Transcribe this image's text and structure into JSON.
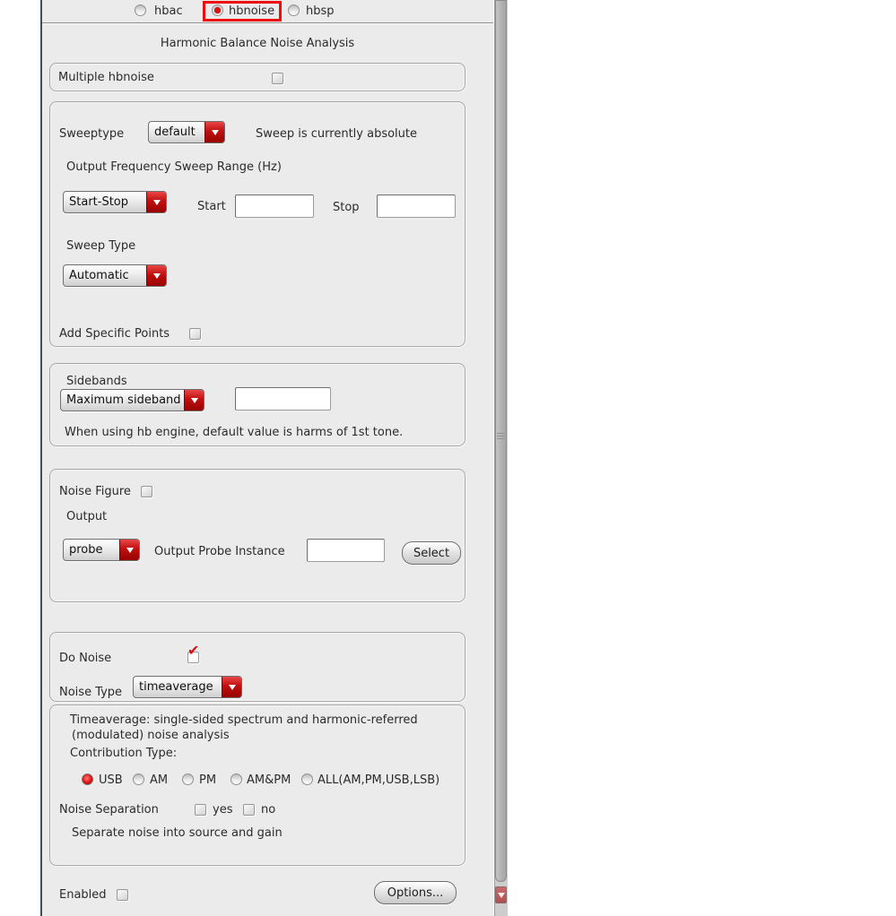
{
  "colors": {
    "accent_red": "#c40b0b",
    "highlight_box": "#ee0d0d",
    "panel_bg": "#ebebeb",
    "text": "#2b2b2b"
  },
  "icons": {
    "checkmark": "✔",
    "dropdown_arrow": "triangle-down",
    "scroll_down": "triangle-down"
  },
  "analysis_tabs": {
    "items": [
      {
        "label": "hbac",
        "selected": false
      },
      {
        "label": "hbnoise",
        "selected": true,
        "highlighted": true
      },
      {
        "label": "hbsp",
        "selected": false
      }
    ]
  },
  "header": {
    "title": "Harmonic Balance Noise Analysis"
  },
  "multiple_hbnoise": {
    "label": "Multiple hbnoise",
    "checked": false
  },
  "sweep_section": {
    "sweeptype_label": "Sweeptype",
    "sweeptype_value": "default",
    "sweep_status": "Sweep is currently absolute",
    "range_title": "Output Frequency Sweep Range (Hz)",
    "range_mode_value": "Start-Stop",
    "start_label": "Start",
    "start_value": "",
    "stop_label": "Stop",
    "stop_value": "",
    "sweep_type_label": "Sweep Type",
    "sweep_type_value": "Automatic",
    "add_points_label": "Add Specific Points",
    "add_points_checked": false
  },
  "sidebands_section": {
    "label": "Sidebands",
    "mode_value": "Maximum sideband",
    "value": "",
    "note": "When using hb engine, default value is harms of 1st tone."
  },
  "noise_figure_section": {
    "label": "Noise Figure",
    "checked": false,
    "output_label": "Output",
    "output_mode_value": "probe",
    "probe_label": "Output Probe Instance",
    "probe_value": "",
    "select_button": "Select"
  },
  "do_noise_section": {
    "do_noise_label": "Do Noise",
    "do_noise_checked": true,
    "type_label": "Noise Type",
    "type_value": "timeaverage",
    "description_line1": "Timeaverage: single-sided spectrum and harmonic-referred",
    "description_line2": "(modulated) noise analysis",
    "contribution_label": "Contribution Type:",
    "contribution_options": [
      {
        "label": "USB",
        "selected": true
      },
      {
        "label": "AM",
        "selected": false
      },
      {
        "label": "PM",
        "selected": false
      },
      {
        "label": "AM&PM",
        "selected": false
      },
      {
        "label": "ALL(AM,PM,USB,LSB)",
        "selected": false
      }
    ],
    "separation_label": "Noise Separation",
    "separation_yes_label": "yes",
    "separation_yes_checked": false,
    "separation_no_label": "no",
    "separation_no_checked": false,
    "separation_note": "Separate noise into source and gain"
  },
  "footer": {
    "enabled_label": "Enabled",
    "enabled_checked": false,
    "options_button": "Options..."
  }
}
